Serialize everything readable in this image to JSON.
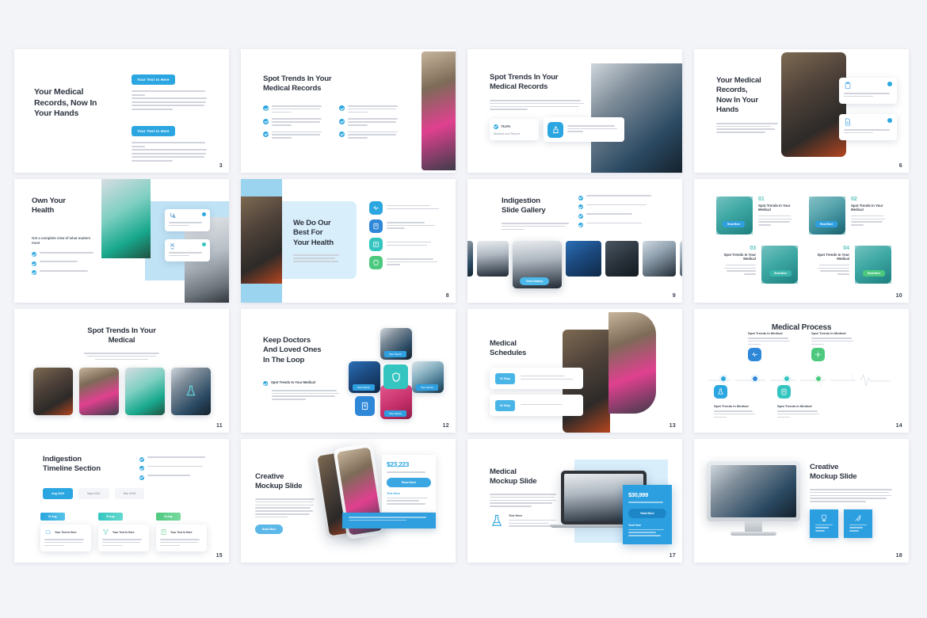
{
  "meta": {
    "background": "#f3f4f8",
    "accent_blue": "#2ba6e0",
    "accent_deep_blue": "#1f8fd6",
    "accent_teal": "#35c5c0",
    "accent_green": "#4cc97f",
    "accent_pink": "#e5558e",
    "title_color": "#2e3440"
  },
  "slides": [
    {
      "number": "3",
      "name": "your-medical-records-now-in-your-hands",
      "title": "Your Medical\nRecords, Now In\nYour Hands",
      "blocks": [
        {
          "label": "Your Text In Here",
          "body": "A wonderful serenity has taken possession of my entire soul, like these sweet mornings of spring which I enjoy with my whole heart. I am alone, and feel the charm of existence in this spot, which was created for the bliss of souls like mine. I am so happy, my dear friend."
        },
        {
          "label": "Your Text In Here",
          "body": "A wonderful serenity has taken possession of my entire soul, like these sweet mornings of spring which I enjoy with my whole heart. I am alone, and feel the charm of existence in this spot, which was created for the bliss of souls like mine. I am so happy, my dear friend."
        }
      ]
    },
    {
      "number": "",
      "name": "spot-trends-in-your-medical-records-bullets",
      "title": "Spot Trends In Your\nMedical Records",
      "bullets": [
        "A wonderful serenity has taken possession my entire soul, like these sweet",
        "A wonderful serenity has taken possession my entire soul, like these sweet",
        "A wonderful serenity has taken possession my entire soul, like these sweet",
        "A wonderful serenity has taken possession my entire soul, like these sweet",
        "A wonderful serenity has taken possession my entire soul, like these sweet",
        "A wonderful serenity has taken possession my entire soul, like these sweet"
      ],
      "image_alt": "nurse-taking-blood-pressure"
    },
    {
      "number": "",
      "name": "spot-trends-in-your-medical-records-stats",
      "title": "Spot Trends In Your\nMedical Records",
      "body": "A wonderful serenity has taken possession of my entire soul, like these sweet mornings of spring which I enjoy with my whole heart. I am alone, and feel the charm of existence in this spot, which was.",
      "stat": {
        "value": "75.0%",
        "caption": "Medical and Report"
      },
      "feature": {
        "icon": "medical-icon",
        "text": "A wonderful serenity has taken possession my entire soul, like these sweet."
      },
      "image_alt": "lab-technician-at-microscope"
    },
    {
      "number": "6",
      "name": "your-medical-records-now-in-your-hands-cards",
      "title": "Your Medical\nRecords,\nNow In Your\nHands",
      "body": "A wonderful serenity has taken of my entire soul, like these sweet mornings of spring which I enjoy with my whole heart. I am alone, and feel the charm of existence.",
      "cards": [
        {
          "icon": "clipboard-icon",
          "text": "A wonderful serenity has taken possession my"
        },
        {
          "icon": "document-icon",
          "text": "A wonderful serenity has taken possession my"
        }
      ],
      "image_alt": "scientist-with-test-tubes"
    },
    {
      "number": "",
      "name": "own-your-health",
      "title": "Own Your\nHealth",
      "subtitle": "Get a complete view of what matters most",
      "bullets": [
        "A wonderful serenity has taken possession",
        "I enjoy with my whole heart",
        "I am alone, and feel the charm existence"
      ],
      "cards": [
        {
          "icon": "stethoscope-icon",
          "text": "A wonderful serenity has been possession my"
        },
        {
          "icon": "dna-icon",
          "text": "A wonderful serenity has been possession my"
        }
      ],
      "image_alt": "pipette-and-sample-tray"
    },
    {
      "number": "8",
      "name": "we-do-our-best-for-your-health",
      "title": "We Do Our\nBest For\nYour Health",
      "body": "A wonderful spring has taken possession of my entire soul, like these sweet mornings of spring which.",
      "features": [
        {
          "icon": "heart-monitor-icon",
          "color": "#2ba6e0",
          "text": "A wonderful serenity has taken possession"
        },
        {
          "icon": "report-icon",
          "color": "#2f87d8",
          "text": "Like these sweet mornings of spring which"
        },
        {
          "icon": "notes-icon",
          "color": "#35c5c0",
          "text": "I am alone, and feel the charm of existence"
        },
        {
          "icon": "shield-icon",
          "color": "#4cc97f",
          "text": "Which was created for the bliss of souls like mine"
        }
      ],
      "image_alt": "scientist-in-lab-coat"
    },
    {
      "number": "9",
      "name": "indigestion-slide-gallery",
      "title": "Indigestion\nSlide Gallery",
      "body": "A wonderful serenity has been possession of my entire soul, like these sweet.",
      "bullets": [
        "But I must explain to you how all",
        "The mistaken idea of denouncing",
        "Pleasure and praising pain",
        "Was born and I will give you a",
        ""
      ],
      "button": "View Gallery",
      "gallery_count": 7
    },
    {
      "number": "10",
      "name": "numbered-medical-cards",
      "items": [
        {
          "number": "01",
          "title": "Spot Trends In Your Medical",
          "body": "A wonderful serenity has taken possession my entire soul like these sweet",
          "button": "Read More"
        },
        {
          "number": "02",
          "title": "Spot Trends In Your Medical",
          "body": "A wonderful serenity has taken possession my entire soul like these sweet",
          "button": "Read More"
        },
        {
          "number": "03",
          "title": "Spot Trends In Your Medical",
          "body": "A wonderful serenity has taken possession my entire soul like these sweet",
          "button": "Read More"
        },
        {
          "number": "04",
          "title": "Spot Trends In Your Medical",
          "body": "A wonderful serenity has taken possession my entire soul like these sweet",
          "button": "Read More"
        }
      ]
    },
    {
      "number": "11",
      "name": "spot-trends-in-your-medical-gallery",
      "title": "Spot Trends In Your\nMedical",
      "body": "A wonderful serenity has taken of my whole soul, like these sweet mornings of spring which I enjoy with my whole heart. I am alone, and",
      "image_count": 4
    },
    {
      "number": "12",
      "name": "keep-doctors-and-loved-ones-in-the-loop",
      "title": "Keep Doctors\nAnd Loved Ones\nIn The Loop",
      "bullet_heading": "Spot Trends In Your Medical",
      "body": "A wonderful serenity has taken of my entire soul, like these sweet mornings of spring which I enjoy with my whole heart. I am alone, and feel the charm of existence.",
      "tiles": [
        {
          "alt": "surgeon-at-microscope",
          "caption": "Your Text In"
        },
        {
          "alt": "operating-team",
          "caption": "Your Text In"
        },
        {
          "alt": "doctor-with-mask",
          "caption": "Your Text In"
        },
        {
          "alt": "smiling-nurse",
          "caption": "Your Text In"
        }
      ],
      "center_icon": "shield-heart-icon"
    },
    {
      "number": "13",
      "name": "medical-schedules",
      "title": "Medical\nSchedules",
      "rows": [
        {
          "badge": "01 Step",
          "text": "Check for emerging medical problems. A wonderful serenity has taken possession"
        },
        {
          "badge": "02 Step",
          "text": "Assess your risk of future medical issues"
        }
      ],
      "image_alt": "nurse-measuring-patient-blood-pressure"
    },
    {
      "number": "14",
      "name": "medical-process-timeline",
      "title": "Medical Process",
      "steps": [
        {
          "marker": "1",
          "title": "Spot Trends In Medical",
          "body": "A wonderful serenity has taken possession my entire soul, like these sweet",
          "icon": "lab-icon",
          "color": "#2ba6e0",
          "position": "bottom"
        },
        {
          "marker": "2",
          "title": "Spot Trends In Medical",
          "body": "A wonderful serenity has taken possession my entire soul, like these sweet",
          "icon": "heart-rate-icon",
          "color": "#2f87d8",
          "position": "top"
        },
        {
          "marker": "3",
          "title": "Spot Trends In Medical",
          "body": "A wonderful serenity has taken possession my entire soul, like these sweet",
          "icon": "report-icon",
          "color": "#35c5c0",
          "position": "bottom"
        },
        {
          "marker": "4",
          "title": "Spot Trends In Medical",
          "body": "A wonderful serenity has taken possession my entire soul, like these sweet",
          "icon": "gear-icon",
          "color": "#4cc97f",
          "position": "top"
        }
      ]
    },
    {
      "number": "15",
      "name": "indigestion-timeline-section",
      "title": "Indigestion\nTimeline Section",
      "bullets": [
        "But I must explain to you how all",
        "The mistaken idea of denouncing",
        "Pleasure and praising pain"
      ],
      "tabs": [
        {
          "label": "Aug 2020",
          "active": true
        },
        {
          "label": "Sept 2021",
          "active": false
        },
        {
          "label": "Mar 2018",
          "active": false
        }
      ],
      "cards": [
        {
          "tag": "01 Aug",
          "tag_color": "#2ba6e0",
          "icon": "cloud-icon",
          "title": "Your Text In Here",
          "body": "A wonderful serenity has taken possession of my entire soul, like these sweet"
        },
        {
          "tag": "02 Aug",
          "tag_color": "#35c5c0",
          "icon": "network-icon",
          "title": "Your Text In Here",
          "body": "A wonderful serenity has taken possession of my entire soul, like these sweet"
        },
        {
          "tag": "03 Aug",
          "tag_color": "#4cc97f",
          "icon": "book-icon",
          "title": "Your Text In Here",
          "body": "A wonderful serenity has taken possession of my entire soul, like these sweet"
        }
      ]
    },
    {
      "number": "",
      "name": "creative-mockup-slide-phone",
      "title": "Creative\nMockup Slide",
      "body": "Ut wisi enim ad minim veniam, quis nostrud exerci tation ullamcorper nisl nostrud exerci tation ullamcorper suscipit lobortis nisl ut aliquip ex ea commodo consequat. Ut wisi enim ad minim veniam, quis nostrud exerci ut lacreet dolore magna aliquam erat volutpat.",
      "button": "Read More",
      "stat_value": "$23,223",
      "stat_caption": "Ut wisi enim ad minim veniam",
      "sub_heading": "Text Here",
      "sub_body": "Ut wisi enim ad minim veniam nostrud exerci tation ullamcorper suscipit lobortis nisl",
      "overlay_text": "A wonderful serenity has taken possession of my entire soul, like these sweet mornings of spring which I enjoy with my whole heart."
    },
    {
      "number": "17",
      "name": "medical-mockup-slide-laptop",
      "title": "Medical\nMockup Slide",
      "body": "Ut wisi enim ad minim veniam, quis nostrud exerci tation ullamcorper suscipit lobortis nisl ut aliquip ex ea commodo consequat. Ut wisi enim ad minim veniam, quis nostrud exerci ut lacreet dolore.",
      "feature": {
        "icon": "flask-icon",
        "title": "Text Here",
        "body": "Ut wisi enim ad minim veniam quis nostrud exerci tation ullamcorper suscipit lobortis nisl"
      },
      "stat_value": "$30,999",
      "stat_caption": "Ut wisi enim ad minim veniam",
      "button": "Read More",
      "sub_heading": "Text Here",
      "sub_body": "Ut wisi enim ad minim veniam quis nostrud exerci tation ullamcorper suscipit lobortis nisl"
    },
    {
      "number": "18",
      "name": "creative-mockup-slide-desktop",
      "title": "Creative\nMockup Slide",
      "body": "Ut wisi enim ad minim veniam, quis nostrud exerci tation ullamcorper suscipit lobortis nisl ut aliquip ex ea commodo consequat. Ut wisi enim ad minim veniam, quis nostrud exerci ut lacreet dolore magna aliquam erat volutpat.",
      "tiles": [
        {
          "icon": "tooth-icon",
          "text": "The quick brown fox jumps"
        },
        {
          "icon": "syringe-icon",
          "text": "The quick brown fox jumps"
        }
      ],
      "image_alt": "scientist-using-microscope"
    }
  ]
}
